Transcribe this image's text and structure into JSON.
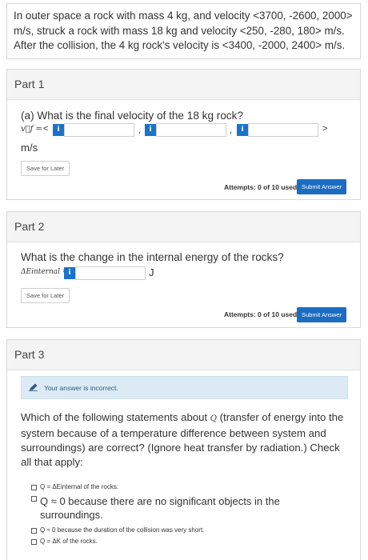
{
  "problem": {
    "text": "In outer space a rock with mass 4 kg, and velocity <3700, -2600, 2000> m/s, struck a rock with mass 18 kg and velocity <250, -280, 180> m/s. After the collision, the 4 kg rock's velocity is <3400, -2000, 2400> m/s."
  },
  "part1": {
    "title": "Part 1",
    "question": "(a) What is the final velocity of the 18 kg rock?",
    "vector_symbol": "v⃗f =",
    "open_bracket": "<",
    "comma": ",",
    "close_bracket": ">",
    "info_label": "i",
    "unit": "m/s",
    "save_label": "Save for Later",
    "attempts": "Attempts: 0 of 10 used",
    "submit_label": "Submit Answer"
  },
  "part2": {
    "title": "Part 2",
    "question": "What is the change in the internal energy of the rocks?",
    "delta_symbol": "ΔEinternal =",
    "info_label": "i",
    "unit": "J",
    "save_label": "Save for Later",
    "attempts": "Attempts: 0 of 10 used",
    "submit_label": "Submit Answer"
  },
  "part3": {
    "title": "Part 3",
    "alert": "Your answer is incorrect.",
    "statement_1": "Which of the following statements about",
    "statement_q": "Q",
    "statement_2": "(transfer of energy into the system because of a temperature difference between system and surroundings) are correct? (Ignore heat transfer by radiation.) Check all that apply:",
    "options": [
      "Q = ΔEinternal of the rocks.",
      "Q ≈ 0 because there are no significant objects in the surroundings.",
      "Q ≈ 0 because the duration of the collision was very short.",
      "Q = ΔK of the rocks."
    ]
  }
}
